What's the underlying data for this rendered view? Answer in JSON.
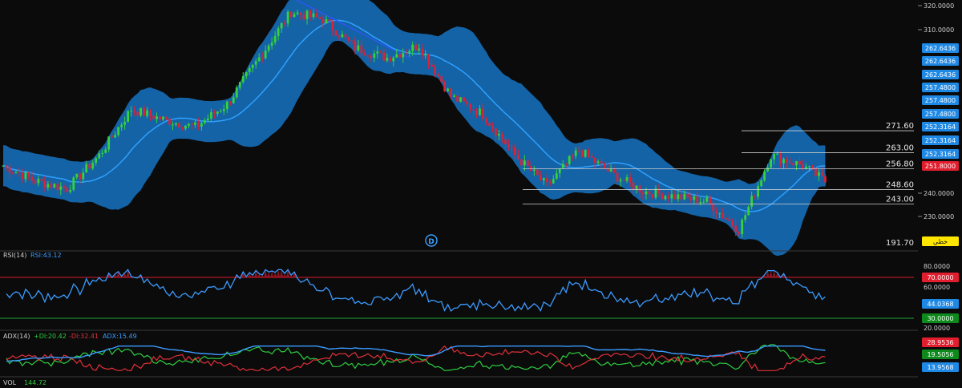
{
  "colors": {
    "background": "#0b0b0b",
    "band_fill": "#1676c8",
    "band_line": "#2ea0ff",
    "up": "#36d13c",
    "down": "#d6243c",
    "grid": "#333333",
    "axis_text": "#cfcfcf",
    "badge_blue": "#1e88e5",
    "badge_red": "#e01e2e",
    "badge_green": "#0e8a1c",
    "badge_yellow": "#ffe600",
    "rsi_line": "#3b9bff",
    "rsi_upper": "#d9192b",
    "rsi_lower": "#1fa13a",
    "plus_di": "#2ecc40",
    "minus_di": "#e0303a",
    "adx": "#3b9bff"
  },
  "price_panel": {
    "axis_ticks": [
      "320.0000",
      "310.0000",
      "240.0000",
      "230.0000"
    ],
    "badges_blue": [
      "262.6436",
      "262.6436",
      "262.6436",
      "257.4800",
      "257.4800",
      "257.4800",
      "252.3164",
      "252.3164",
      "252.3164"
    ],
    "current_price": "251.8000",
    "level_labels": [
      "271.60",
      "263.00",
      "256.80",
      "248.60",
      "243.00"
    ],
    "level_values": [
      271.6,
      263.0,
      256.8,
      248.6,
      243.0
    ],
    "low_label": "191.70",
    "tag_label": "خطي",
    "watermark": "D"
  },
  "rsi_panel": {
    "title": "RSI(14)",
    "value_label": "RSI:43.12",
    "ticks": [
      "80.0000",
      "60.0000",
      "20.0000"
    ],
    "upper_badge": "70.0000",
    "value_badge": "44.0368",
    "lower_badge": "30.0000",
    "upper": 70,
    "lower": 30
  },
  "adx_panel": {
    "title": "ADX(14)",
    "plus_di_label": "+DI:20.42",
    "minus_di_label": "-DI:32.41",
    "adx_label": "ADX:15.49",
    "badges": [
      "28.9536",
      "19.5056",
      "13.9568"
    ]
  },
  "vol_panel": {
    "title": "VOL",
    "value": "144.72"
  },
  "chart_data": {
    "type": "candlestick",
    "title": "",
    "price_axis": {
      "min": 225,
      "max": 322
    },
    "indicators": [
      "Bollinger Bands",
      "RSI(14)",
      "ADX(14)",
      "VOL"
    ],
    "close_path": [
      {
        "i": 0,
        "v": 258
      },
      {
        "i": 10,
        "v": 252
      },
      {
        "i": 20,
        "v": 249
      },
      {
        "i": 30,
        "v": 262
      },
      {
        "i": 40,
        "v": 280
      },
      {
        "i": 50,
        "v": 276
      },
      {
        "i": 60,
        "v": 273
      },
      {
        "i": 70,
        "v": 282
      },
      {
        "i": 80,
        "v": 300
      },
      {
        "i": 90,
        "v": 318
      },
      {
        "i": 100,
        "v": 315
      },
      {
        "i": 110,
        "v": 304
      },
      {
        "i": 120,
        "v": 300
      },
      {
        "i": 130,
        "v": 305
      },
      {
        "i": 140,
        "v": 285
      },
      {
        "i": 150,
        "v": 278
      },
      {
        "i": 160,
        "v": 262
      },
      {
        "i": 170,
        "v": 250
      },
      {
        "i": 180,
        "v": 264
      },
      {
        "i": 190,
        "v": 255
      },
      {
        "i": 200,
        "v": 248
      },
      {
        "i": 210,
        "v": 246
      },
      {
        "i": 220,
        "v": 244
      },
      {
        "i": 230,
        "v": 233
      },
      {
        "i": 240,
        "v": 262
      },
      {
        "i": 250,
        "v": 258
      },
      {
        "i": 257,
        "v": 251.8
      }
    ],
    "rsi_last": 43.12,
    "plus_di_last": 20.42,
    "minus_di_last": 32.41,
    "adx_last": 15.49,
    "volume_last": 144.72
  }
}
